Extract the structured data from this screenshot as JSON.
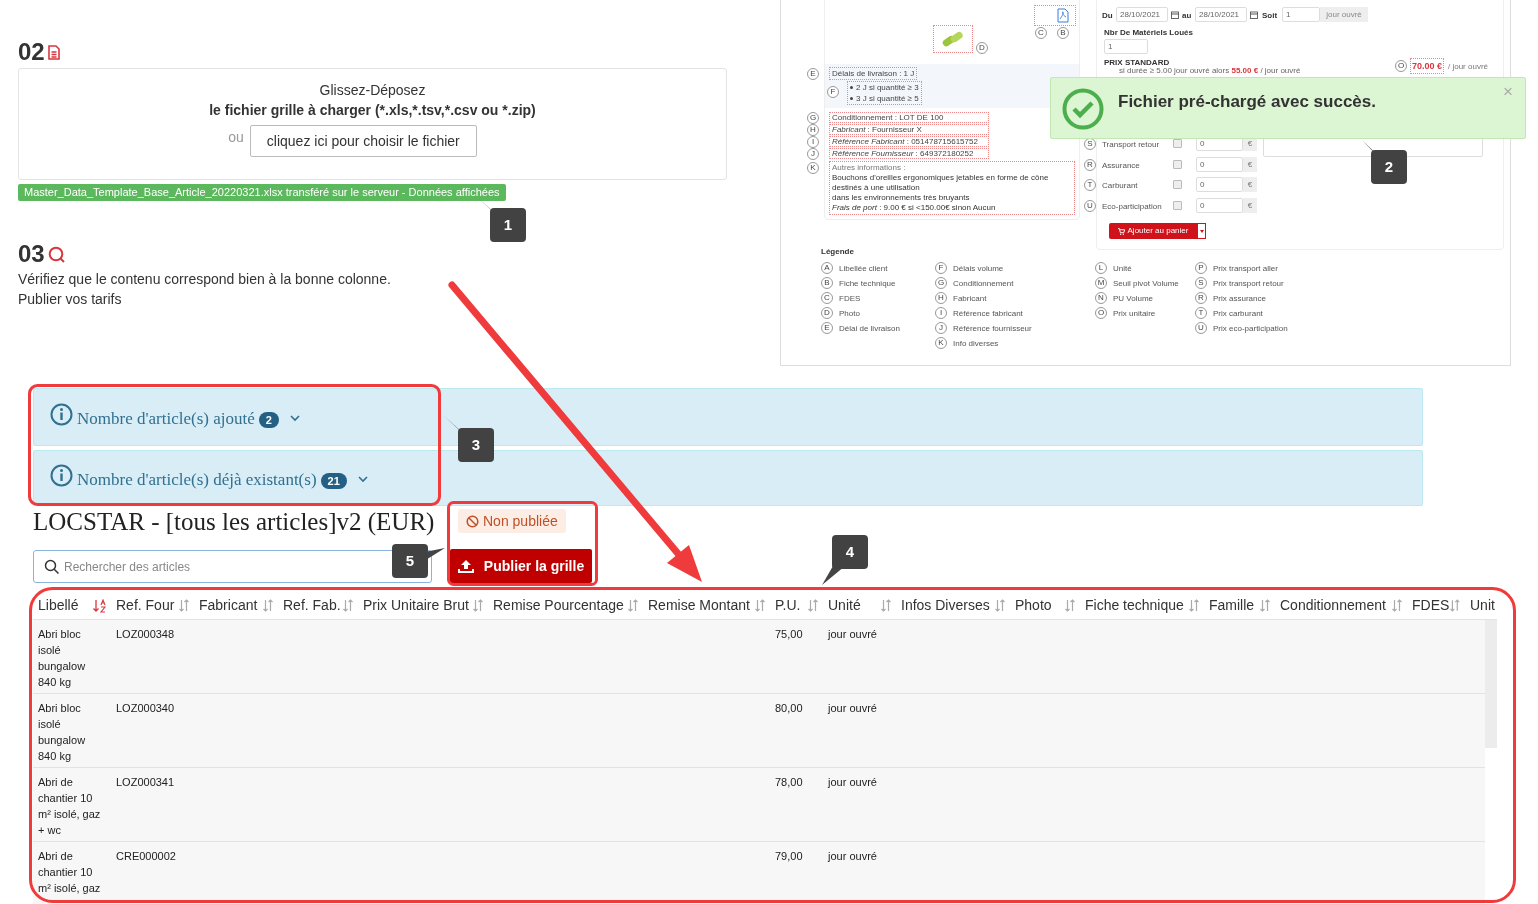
{
  "upload_step": {
    "number": "02",
    "drop_hint": "Glissez-Déposez",
    "drop_formats": "le fichier grille à charger (*.xls,*.tsv,*.csv ou *.zip)",
    "or": "ou",
    "choose_button": "cliquez ici pour choisir le fichier",
    "status": "Master_Data_Template_Base_Article_20220321.xlsx transféré sur le serveur - Données affichées"
  },
  "review_step": {
    "number": "03",
    "lines": [
      "Vérifiez que le contenu correspond bien à la bonne colonne.",
      "Publier vos tarifs"
    ]
  },
  "preview": {
    "product": {
      "pdf_markers": [
        "C",
        "B"
      ],
      "photo_marker": "D",
      "delivery": {
        "marker": "E",
        "text": "Délais de livraison : 1 J"
      },
      "volume_delays": {
        "marker": "F",
        "items": [
          "2 J si quantité ≥ 3",
          "3 J si quantité ≥ 5"
        ]
      },
      "details": [
        {
          "marker": "G",
          "text": "Conditionnement : LOT DE 100"
        },
        {
          "marker": "H",
          "text": "*Fabricant* : Fournisseur X"
        },
        {
          "marker": "I",
          "text": "*Référence Fabricant* : 051478715615752"
        },
        {
          "marker": "J",
          "text": "*Référence Fournisseur* : 649372180252"
        }
      ],
      "other_info": {
        "marker": "K",
        "title": "Autres informations :",
        "lines": [
          "Bouchons d'oreilles ergonomiques jetables en forme de cône destinés à une utilisation",
          "dans les environnements très bruyants",
          "*Frais de port* : 9.00 € si <150.00€ sinon Aucun"
        ]
      }
    },
    "booking": {
      "from_label": "Du",
      "from": "28/10/2021",
      "to_label": "au",
      "to": "28/10/2021",
      "duration_label": "Soit",
      "duration": "1",
      "duration_unit": "jour ouvré",
      "quantity_label": "Nbr De Matériels Loués",
      "quantity": "1",
      "price_label": "PRIX STANDARD",
      "volume_rule": "si durée ≥ 5.00 jour ouvré alors **55.00 €** / jour ouvré",
      "price_marker": "O",
      "price": "70.00 €",
      "price_unit": "/ jour ouvré",
      "extras": [
        {
          "marker": "S",
          "label": "Transport retour",
          "checked": false,
          "value": "0",
          "currency": "€"
        },
        {
          "marker": "R",
          "label": "Assurance",
          "checked": false,
          "value": "0",
          "currency": "€"
        },
        {
          "marker": "T",
          "label": "Carburant",
          "checked": false,
          "value": "0",
          "currency": "€"
        },
        {
          "marker": "U",
          "label": "Eco-participation",
          "checked": false,
          "value": "0",
          "currency": "€"
        }
      ],
      "cart_button": "Ajouter au panier"
    },
    "legend": {
      "title": "Légende",
      "columns": [
        [
          {
            "marker": "A",
            "label": "Libellée client"
          },
          {
            "marker": "B",
            "label": "Fiche technique"
          },
          {
            "marker": "C",
            "label": "FDES"
          },
          {
            "marker": "D",
            "label": "Photo"
          },
          {
            "marker": "E",
            "label": "Délai de livraison"
          }
        ],
        [
          {
            "marker": "F",
            "label": "Délais volume"
          },
          {
            "marker": "G",
            "label": "Conditionnement"
          },
          {
            "marker": "H",
            "label": "Fabricant"
          },
          {
            "marker": "I",
            "label": "Référence fabricant"
          },
          {
            "marker": "J",
            "label": "Référence fournisseur"
          },
          {
            "marker": "K",
            "label": "Info diverses"
          }
        ],
        [
          {
            "marker": "L",
            "label": "Unité"
          },
          {
            "marker": "M",
            "label": "Seuil pivot Volume"
          },
          {
            "marker": "N",
            "label": "PU Volume"
          },
          {
            "marker": "O",
            "label": "Prix unitaire"
          }
        ],
        [
          {
            "marker": "P",
            "label": "Prix transport aller"
          },
          {
            "marker": "S",
            "label": "Prix transport retour"
          },
          {
            "marker": "R",
            "label": "Prix assurance"
          },
          {
            "marker": "T",
            "label": "Prix carburant"
          },
          {
            "marker": "U",
            "label": "Prix eco-participation"
          }
        ]
      ]
    }
  },
  "toast": {
    "message": "Fichier pré-chargé avec succès.",
    "close": "×"
  },
  "summary_panels": [
    {
      "label": "Nombre d'article(s) ajouté",
      "count": "2",
      "expanded": false
    },
    {
      "label": "Nombre d'article(s) déjà existant(s)",
      "count": "21",
      "expanded": false
    }
  ],
  "grid": {
    "title": "LOCSTAR - [tous les articles]v2 (EUR)",
    "publish_status": "Non publiée",
    "publish_button": "Publier la grille",
    "search": {
      "placeholder": "Rechercher des articles"
    },
    "columns": [
      {
        "label": "Libellé",
        "sorted": true
      },
      {
        "label": "Ref. Four",
        "sorted": false
      },
      {
        "label": "Fabricant",
        "sorted": false
      },
      {
        "label": "Ref. Fab.",
        "sorted": false
      },
      {
        "label": "Prix Unitaire Brut",
        "sorted": false
      },
      {
        "label": "Remise Pourcentage",
        "sorted": false
      },
      {
        "label": "Remise Montant",
        "sorted": false
      },
      {
        "label": "P.U.",
        "sorted": false
      },
      {
        "label": "Unité",
        "sorted": false
      },
      {
        "label": "Infos Diverses",
        "sorted": false
      },
      {
        "label": "Photo",
        "sorted": false
      },
      {
        "label": "Fiche technique",
        "sorted": false
      },
      {
        "label": "Famille",
        "sorted": false
      },
      {
        "label": "Conditionnement",
        "sorted": false
      },
      {
        "label": "FDES",
        "sorted": false
      },
      {
        "label": "Unit"
      }
    ],
    "rows": [
      {
        "label": "Abri bloc isolé bungalow 840 kg",
        "ref_four": "LOZ000348",
        "unit_price": "75,00",
        "unit": "jour ouvré"
      },
      {
        "label": "Abri bloc isolé bungalow 840 kg",
        "ref_four": "LOZ000340",
        "unit_price": "80,00",
        "unit": "jour ouvré"
      },
      {
        "label": "Abri de chantier 10 m² isolé, gaz + wc",
        "ref_four": "LOZ000341",
        "unit_price": "78,00",
        "unit": "jour ouvré"
      },
      {
        "label": "Abri de chantier 10 m² isolé, gaz",
        "ref_four": "CRE000002",
        "unit_price": "79,00",
        "unit": "jour ouvré"
      }
    ]
  },
  "callouts": [
    "1",
    "2",
    "3",
    "4",
    "5"
  ]
}
